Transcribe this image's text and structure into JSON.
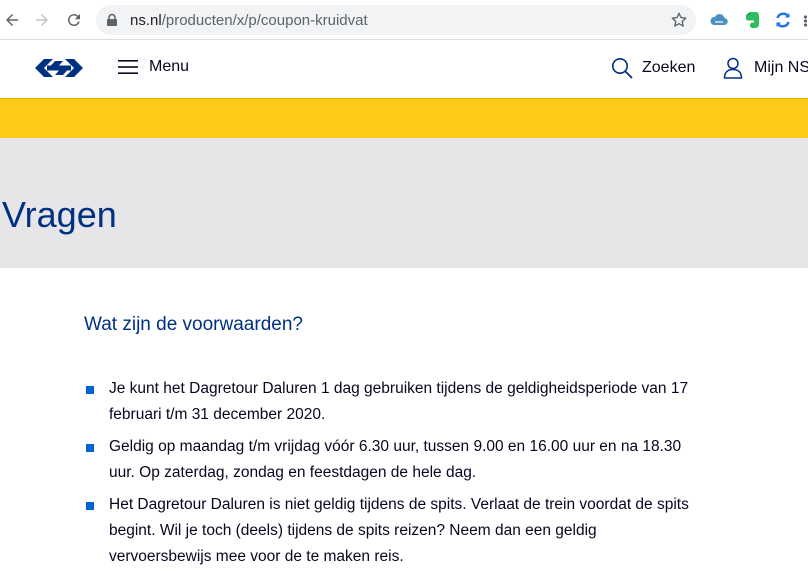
{
  "browser": {
    "url_domain": "ns.nl",
    "url_path": "/producten/x/p/coupon-kruidvat"
  },
  "header": {
    "menu_label": "Menu",
    "search_label": "Zoeken",
    "account_label": "Mijn NS"
  },
  "hero": {
    "title": "Vragen"
  },
  "faq": {
    "question": "Wat zijn de voorwaarden?",
    "items": [
      "Je kunt het Dagretour Daluren 1 dag gebruiken tijdens de geldigheidsperiode van 17 februari t/m 31 december 2020.",
      "Geldig op maandag t/m vrijdag vóór 6.30 uur, tussen 9.00 en 16.00 uur en na 18.30 uur. Op zaterdag, zondag en feestdagen de hele dag.",
      "Het Dagretour Daluren is niet geldig tijdens de spits. Verlaat de trein voordat de spits begint. Wil je toch (deels) tijdens de spits reizen? Neem dan een geldig vervoersbewijs mee voor de te maken reis."
    ]
  },
  "colors": {
    "brand_blue": "#003082",
    "brand_yellow": "#ffc917",
    "bullet_blue": "#0063d3"
  }
}
